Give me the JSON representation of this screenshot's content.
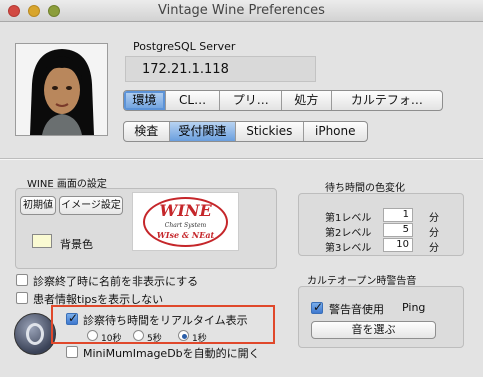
{
  "window": {
    "title": "Vintage Wine Preferences"
  },
  "server": {
    "label": "PostgreSQL Server",
    "address": "172.21.1.118"
  },
  "tabs_row1": [
    "環境",
    "CL…",
    "プリ…",
    "処方",
    "カルテフォ…"
  ],
  "tabs_row2": [
    "検査",
    "受付関連",
    "Stickies",
    "iPhone"
  ],
  "wine_panel": {
    "title": "WINE 画面の設定",
    "btn_default": "初期値",
    "btn_image": "イメージ設定",
    "logo_title": "WINE",
    "logo_sub1": "Chart System",
    "logo_sub2": "WIse & NEat",
    "bg_label": "背景色"
  },
  "wait_panel": {
    "title": "待ち時間の色変化",
    "rows": [
      {
        "label": "第1レベル",
        "value": "1",
        "unit": "分"
      },
      {
        "label": "第2レベル",
        "value": "5",
        "unit": "分"
      },
      {
        "label": "第3レベル",
        "value": "10",
        "unit": "分"
      }
    ]
  },
  "options": {
    "hide_name": "診察終了時に名前を非表示にする",
    "hide_tips": "患者情報tipsを表示しない",
    "realtime": "診察待ち時間をリアルタイム表示",
    "radios": [
      "10秒",
      "5秒",
      "1秒"
    ],
    "minimum": "MiniMumImageDbを自動的に開く"
  },
  "alert_panel": {
    "title": "カルテオープン時警告音",
    "use_label": "警告音使用",
    "sound_name": "Ping",
    "choose_btn": "音を選ぶ"
  },
  "colors": {
    "highlight_box": "#e0482b",
    "accent": "#5c93d8"
  }
}
